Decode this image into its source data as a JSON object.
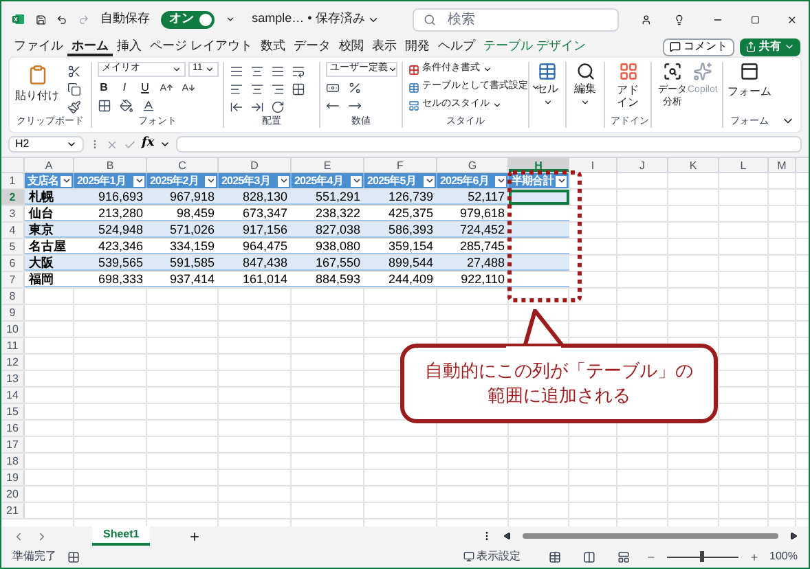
{
  "window": {
    "title": "sample… • 保存済み"
  },
  "autosave": {
    "label": "自動保存",
    "state_text": "オン",
    "on": true
  },
  "search": {
    "placeholder": "検索"
  },
  "menu_tabs": [
    {
      "label": "ファイル",
      "selected": false,
      "kind": "standard"
    },
    {
      "label": "ホーム",
      "selected": true,
      "kind": "standard"
    },
    {
      "label": "挿入",
      "selected": false,
      "kind": "standard"
    },
    {
      "label": "ページ レイアウト",
      "selected": false,
      "kind": "standard"
    },
    {
      "label": "数式",
      "selected": false,
      "kind": "standard"
    },
    {
      "label": "データ",
      "selected": false,
      "kind": "standard"
    },
    {
      "label": "校閲",
      "selected": false,
      "kind": "standard"
    },
    {
      "label": "表示",
      "selected": false,
      "kind": "standard"
    },
    {
      "label": "開発",
      "selected": false,
      "kind": "standard"
    },
    {
      "label": "ヘルプ",
      "selected": false,
      "kind": "standard"
    },
    {
      "label": "テーブル デザイン",
      "selected": false,
      "kind": "contextual"
    }
  ],
  "comment_button": "コメント",
  "share_button": "共有",
  "ribbon": {
    "clipboard": {
      "label": "クリップボード",
      "paste": "貼り付け"
    },
    "font": {
      "label": "フォント",
      "font_name": "メイリオ",
      "font_size": "11",
      "bold": "B",
      "italic": "I",
      "underline": "U"
    },
    "alignment": {
      "label": "配置"
    },
    "number": {
      "label": "数値",
      "format": "ユーザー定義"
    },
    "styles": {
      "label": "スタイル",
      "items": [
        "条件付き書式",
        "テーブルとして書式設定",
        "セルのスタイル"
      ]
    },
    "cells": {
      "button": "セル"
    },
    "editing": {
      "button": "編集"
    },
    "addins": {
      "label": "アドイン",
      "button": "アドイン"
    },
    "analysis": [
      {
        "label": "データ分析",
        "disabled": false
      },
      {
        "label": "Copilot",
        "disabled": true
      }
    ],
    "form": {
      "label": "フォーム",
      "button": "フォーム"
    }
  },
  "formula_bar": {
    "name_box": "H2",
    "function_label": "fx"
  },
  "sheet": {
    "column_letters": [
      "A",
      "B",
      "C",
      "D",
      "E",
      "F",
      "G",
      "H",
      "I",
      "J",
      "K",
      "L",
      "M"
    ],
    "row_numbers": [
      "1",
      "2",
      "3",
      "4",
      "5",
      "6",
      "7",
      "8",
      "9",
      "10",
      "11",
      "12",
      "13",
      "14",
      "15",
      "16",
      "17",
      "18",
      "19",
      "20",
      "21"
    ],
    "table": {
      "headers": [
        "支店名",
        "2025年1月",
        "2025年2月",
        "2025年3月",
        "2025年4月",
        "2025年5月",
        "2025年6月",
        "半期合計"
      ],
      "rows": [
        {
          "cells": [
            "札幌",
            "916,693",
            "967,918",
            "828,130",
            "551,291",
            "126,739",
            "52,117"
          ],
          "total_selected": true
        },
        {
          "cells": [
            "仙台",
            "213,280",
            "98,459",
            "673,347",
            "238,322",
            "425,375",
            "979,618"
          ],
          "total_selected": false
        },
        {
          "cells": [
            "東京",
            "524,948",
            "571,026",
            "917,156",
            "827,038",
            "586,393",
            "724,452"
          ],
          "total_selected": false
        },
        {
          "cells": [
            "名古屋",
            "423,346",
            "334,159",
            "964,475",
            "938,080",
            "359,154",
            "285,745"
          ],
          "total_selected": false
        },
        {
          "cells": [
            "大阪",
            "539,565",
            "591,585",
            "847,438",
            "167,550",
            "899,544",
            "27,488"
          ],
          "total_selected": false
        },
        {
          "cells": [
            "福岡",
            "698,333",
            "937,414",
            "161,014",
            "884,593",
            "244,409",
            "922,110"
          ],
          "total_selected": false
        }
      ]
    }
  },
  "annotation": {
    "text": "自動的にこの列が「テーブル」の範囲に追加される"
  },
  "sheet_tabs": [
    {
      "label": "Sheet1",
      "selected": true
    }
  ],
  "status_bar": {
    "status": "準備完了",
    "display_settings": "表示設定",
    "zoom": "100%",
    "zoom_slider": {
      "level": 0.5
    }
  }
}
